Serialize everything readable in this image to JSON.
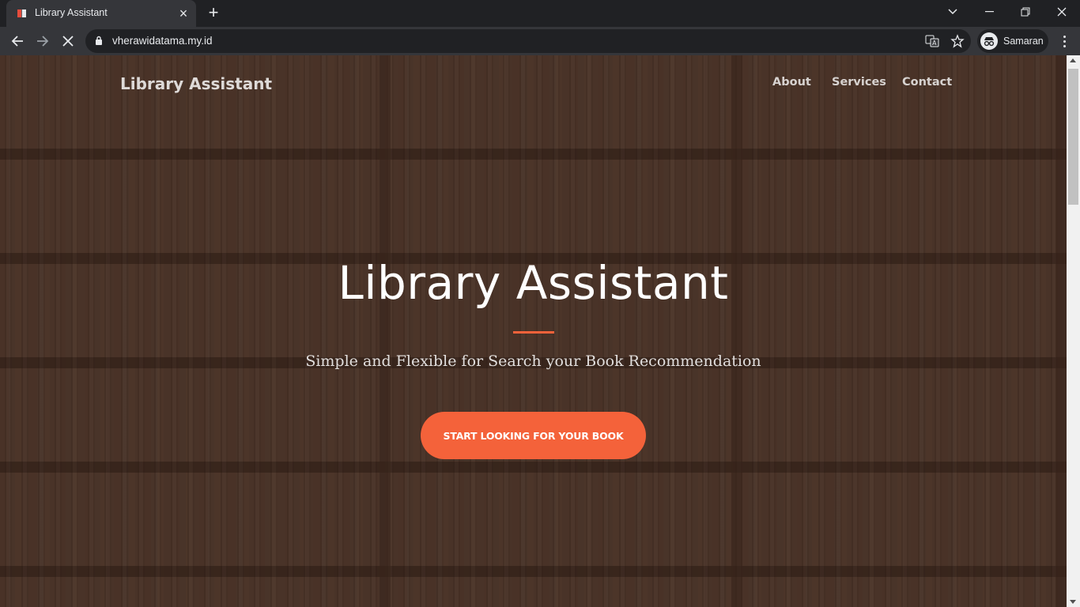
{
  "browser": {
    "tab": {
      "title": "Library Assistant",
      "favicon": "book-favicon",
      "close_icon": "close-icon"
    },
    "new_tab_icon": "plus-icon",
    "window_controls": [
      "chevron-down-icon",
      "minimize-icon",
      "restore-icon",
      "close-icon"
    ],
    "url": "vherawidatama.my.id",
    "profile_name": "Samaran",
    "profile_icon": "incognito-icon",
    "omnibox_icons": [
      "translate-icon",
      "star-icon"
    ],
    "nav_icons": [
      "back-arrow-icon",
      "forward-arrow-icon",
      "stop-loading-icon"
    ]
  },
  "site": {
    "brand": "Library Assistant",
    "nav": [
      {
        "label": "About"
      },
      {
        "label": "Services"
      },
      {
        "label": "Contact"
      }
    ],
    "hero": {
      "title": "Library Assistant",
      "subtitle": "Simple and Flexible for Search your Book Recommendation",
      "cta_label": "START LOOKING FOR YOUR BOOK"
    },
    "accent_color": "#f4623a"
  }
}
